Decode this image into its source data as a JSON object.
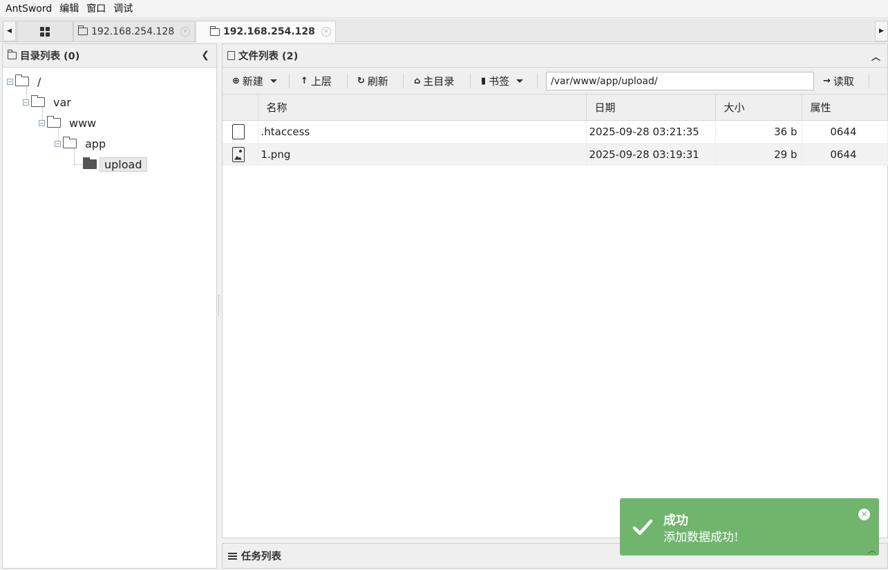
{
  "menu": [
    "AntSword",
    "编辑",
    "窗口",
    "调试"
  ],
  "tabs": [
    {
      "label": "192.168.254.128",
      "active": false
    },
    {
      "label": "192.168.254.128",
      "active": true
    }
  ],
  "left_panel": {
    "title": "目录列表 (0)",
    "tree": [
      {
        "label": "/"
      },
      {
        "label": "var"
      },
      {
        "label": "www"
      },
      {
        "label": "app"
      },
      {
        "label": "upload",
        "selected": true
      }
    ]
  },
  "right_panel": {
    "title": "文件列表 (2)",
    "toolbar": {
      "new_label": "新建",
      "up_label": "上层",
      "refresh_label": "刷新",
      "home_label": "主目录",
      "bookmark_label": "书签",
      "path_value": "/var/www/app/upload/",
      "read_label": "读取"
    },
    "columns": [
      "名称",
      "日期",
      "大小",
      "属性"
    ],
    "files": [
      {
        "name": ".htaccess",
        "date": "2025-09-28 03:21:35",
        "size": "36 b",
        "attr": "0644",
        "icon": "file-icon"
      },
      {
        "name": "1.png",
        "date": "2025-09-28 03:19:31",
        "size": "29 b",
        "attr": "0644",
        "icon": "image-file-icon"
      }
    ]
  },
  "task_panel": {
    "title": "任务列表"
  },
  "toast": {
    "title": "成功",
    "message": "添加数据成功!",
    "color": "#6fb56c"
  }
}
